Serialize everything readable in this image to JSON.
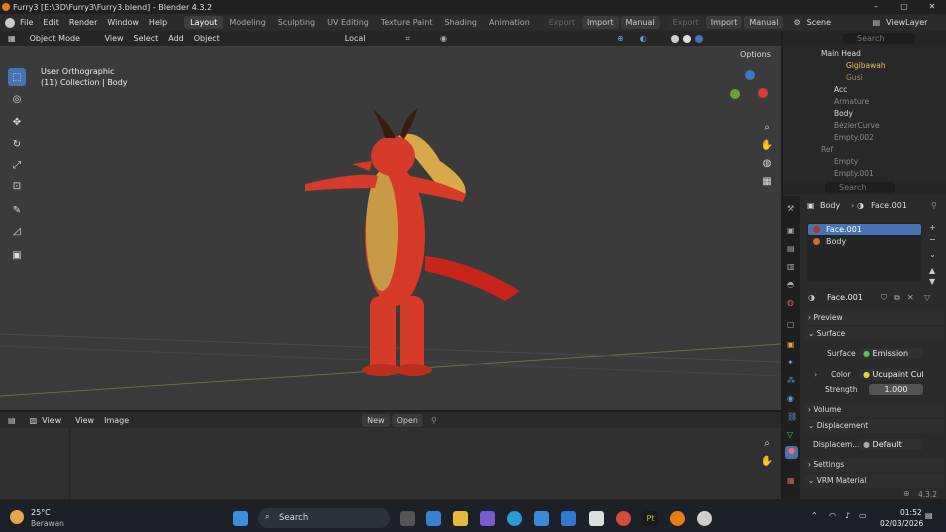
{
  "window": {
    "title": "Furry3 [E:\\3D\\Furry3\\Furry3.blend] - Blender 4.3.2"
  },
  "menu": [
    "File",
    "Edit",
    "Render",
    "Window",
    "Help"
  ],
  "workspaces": [
    "Layout",
    "Modeling",
    "Sculpting",
    "UV Editing",
    "Texture Paint",
    "Shading",
    "Animation"
  ],
  "toolbar_right": {
    "export1": "Export",
    "import1": "Import",
    "manual1": "Manual",
    "export2": "Export",
    "import2": "Import",
    "manual2": "Manual",
    "scene": "Scene",
    "viewlayer": "ViewLayer"
  },
  "viewport": {
    "mode": "Object Mode",
    "menus": [
      "View",
      "Select",
      "Add",
      "Object"
    ],
    "orientation": "Local",
    "options": "Options",
    "view_name": "User Orthographic",
    "collection": "(11) Collection | Body"
  },
  "image_editor": {
    "menus": [
      "View",
      "View",
      "Image"
    ],
    "new": "New",
    "open": "Open"
  },
  "outliner": {
    "search_placeholder": "Search",
    "rows": [
      "Main Head",
      "Gigibawah",
      "Gusi",
      "Acc",
      "Armature",
      "Body",
      "BézierCurve",
      "Empty.002",
      "Ref",
      "Empty",
      "Empty.001"
    ]
  },
  "properties": {
    "search_placeholder": "Search",
    "breadcrumb_object": "Body",
    "breadcrumb_material": "Face.001",
    "slots": [
      "Face.001",
      "Body"
    ],
    "material_name": "Face.001",
    "sections": {
      "preview": "Preview",
      "surface": "Surface",
      "volume": "Volume",
      "displacement": "Displacement",
      "settings": "Settings",
      "vrm": "VRM Material"
    },
    "surface_label": "Surface",
    "surface_value": "Emission",
    "color_label": "Color",
    "color_value": "Ucupaint Cub...",
    "strength_label": "Strength",
    "strength_value": "1.000",
    "displace_label": "Displacem...",
    "displace_value": "Default"
  },
  "status": {
    "version": "4.3.2"
  },
  "taskbar": {
    "temp": "25°C",
    "weather": "Berawan",
    "search": "Search",
    "time": "01:52",
    "date": "02/03/2026"
  },
  "colors": {
    "accent": "#4772b3",
    "active_ws": "#3d3d3d"
  }
}
